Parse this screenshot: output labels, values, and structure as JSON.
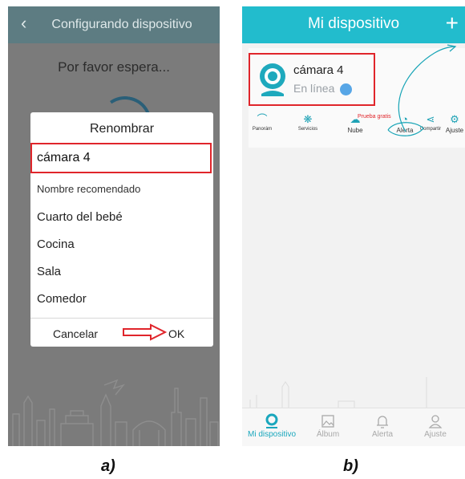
{
  "panel_a": {
    "header": {
      "back_icon": "chevron-left-icon",
      "title": "Configurando dispositivo"
    },
    "waiting_text": "Por favor espera...",
    "dialog": {
      "title": "Renombrar",
      "input_value": "cámara 4",
      "hint": "Nombre recomendado",
      "options": [
        "Cuarto del bebé",
        "Cocina",
        "Sala",
        "Comedor"
      ],
      "cancel_label": "Cancelar",
      "ok_label": "OK"
    },
    "caption": "a)"
  },
  "panel_b": {
    "header": {
      "title": "Mi dispositivo",
      "add_icon": "plus-icon"
    },
    "device": {
      "name": "cámara 4",
      "status": "En línea"
    },
    "actions": [
      {
        "icon": "panorama-icon",
        "label": "Panorám"
      },
      {
        "icon": "services-icon",
        "label": "Servicios"
      },
      {
        "icon": "cloud-icon",
        "label": "Nube",
        "tag": "Prueba gratis"
      },
      {
        "icon": "bell-icon",
        "label": "Alerta"
      },
      {
        "icon": "share-icon",
        "label": "Compartir"
      },
      {
        "icon": "gear-icon",
        "label": "Ajuste"
      }
    ],
    "tabs": [
      {
        "icon": "location-icon",
        "label": "Mi dispositivo",
        "active": true
      },
      {
        "icon": "image-icon",
        "label": "Álbum",
        "active": false
      },
      {
        "icon": "bell-icon",
        "label": "Alerta",
        "active": false
      },
      {
        "icon": "user-icon",
        "label": "Ajuste",
        "active": false
      }
    ],
    "caption": "b)"
  },
  "colors": {
    "header_a": "#5d7c82",
    "header_b": "#22bccd",
    "highlight_red": "#e0252b",
    "accent_teal": "#1aa7bd"
  }
}
